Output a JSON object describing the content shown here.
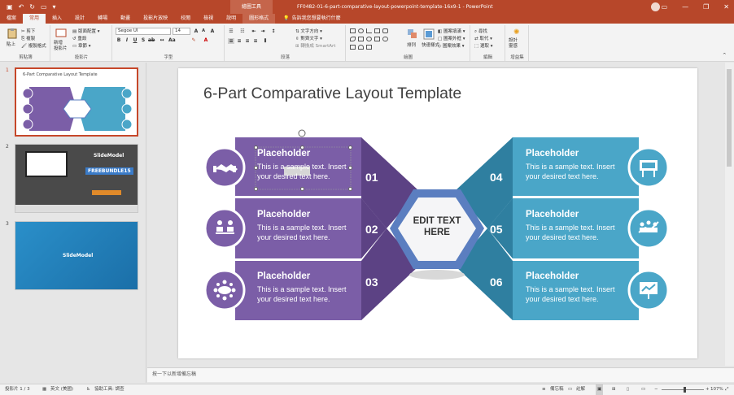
{
  "titlebar": {
    "context_tab_group": "繪圖工具",
    "title": "FF0482-01-6-part-comparative-layout-powerpoint-template-16x9-1  -  PowerPoint"
  },
  "tabs": [
    "檔案",
    "常用",
    "插入",
    "設計",
    "轉場",
    "動畫",
    "投影片放映",
    "校閱",
    "檢視",
    "說明",
    "圖形格式"
  ],
  "active_tab": "常用",
  "tell_me": "告訴我您想要執行什麼",
  "ribbon": {
    "groups": [
      "剪貼簿",
      "投影片",
      "字型",
      "段落",
      "繪圖",
      "編輯",
      "增益集"
    ],
    "paste": "貼上",
    "cut": "剪下",
    "copy": "複製",
    "format_painter": "複製格式",
    "new_slide": "新增\n投影片",
    "layout": "版面配置",
    "reset": "重設",
    "section": "章節",
    "font_name": "Segoe UI",
    "font_size": "14",
    "text_direction": "文字方向",
    "align_text": "對齊文字",
    "smartart": "轉換成 SmartArt",
    "arrange": "排列",
    "quick_styles": "快速樣式",
    "shape_fill": "圖案填滿",
    "shape_outline": "圖案外框",
    "shape_effects": "圖案效果",
    "find": "尋找",
    "replace": "取代",
    "select": "選取",
    "designer": "設計\n靈感"
  },
  "thumbnails": [
    {
      "number": "1",
      "title": "6-Part Comparative Layout Template"
    },
    {
      "number": "2",
      "brand": "SlideModel",
      "promo": "FREEBUNDLE15"
    },
    {
      "number": "3",
      "brand": "SlideModel"
    }
  ],
  "slide": {
    "title": "6-Part Comparative Layout Template",
    "center_text": "EDIT TEXT HERE",
    "items": [
      {
        "num": "01",
        "heading": "Placeholder",
        "body_a": "This is a ",
        "body_selected": "sample",
        "body_b": " text. Insert",
        "body_c": "your desired text here.",
        "icon": "handshake-icon"
      },
      {
        "num": "02",
        "heading": "Placeholder",
        "body_a": "This is a sample text. Insert",
        "body_c": "your desired text here.",
        "icon": "meeting-icon"
      },
      {
        "num": "03",
        "heading": "Placeholder",
        "body_a": "This is a sample text. Insert",
        "body_c": "your desired text here.",
        "icon": "conference-table-icon"
      },
      {
        "num": "04",
        "heading": "Placeholder",
        "body_a": "This is a sample text. Insert",
        "body_c": "your desired text here.",
        "icon": "billboard-icon"
      },
      {
        "num": "05",
        "heading": "Placeholder",
        "body_a": "This is a sample text. Insert",
        "body_c": "your desired text here.",
        "icon": "team-growth-icon"
      },
      {
        "num": "06",
        "heading": "Placeholder",
        "body_a": "This is a sample text. Insert",
        "body_c": "your desired text here.",
        "icon": "presentation-icon"
      }
    ],
    "colors": {
      "purple": "#7b5ea7",
      "purple_dark": "#5c4284",
      "teal": "#4aa6c8",
      "teal_dark": "#2f7fa0"
    }
  },
  "notes_placeholder": "按一下以新增備忘稿",
  "status": {
    "slide_count": "投影片 1 / 3",
    "language": "英文 (美國)",
    "accessibility": "協助工具: 調查",
    "notes": "備忘稿",
    "comments": "註解",
    "zoom": "107%"
  }
}
